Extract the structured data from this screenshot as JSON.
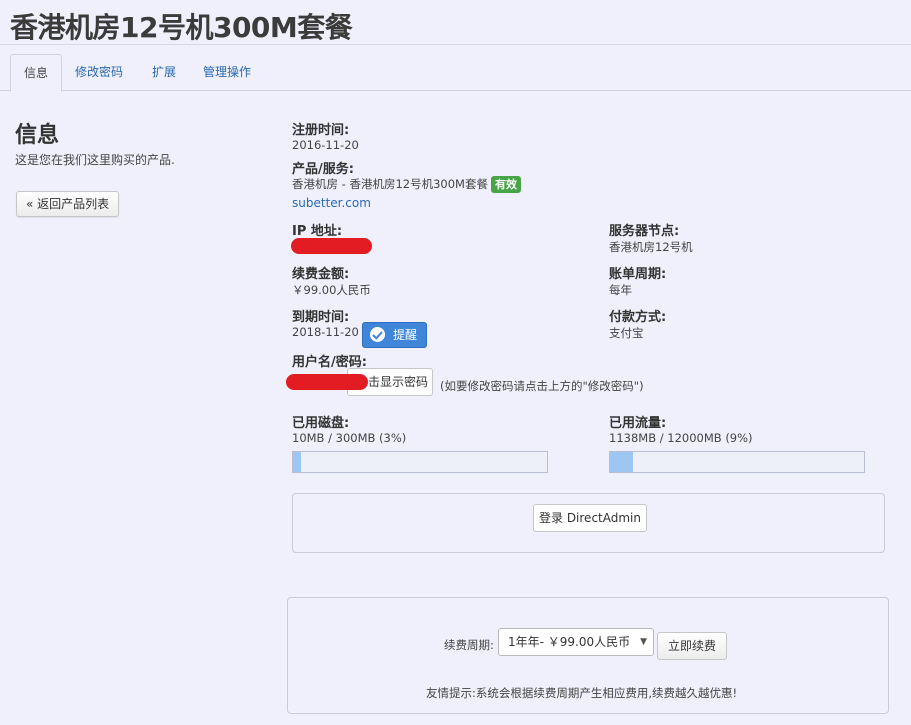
{
  "page": {
    "title": "香港机房12号机300M套餐"
  },
  "tabs": [
    {
      "label": "信息"
    },
    {
      "label": "修改密码"
    },
    {
      "label": "扩展"
    },
    {
      "label": "管理操作"
    }
  ],
  "sidebar": {
    "heading": "信息",
    "description": "这是您在我们这里购买的产品.",
    "back_button": "« 返回产品列表"
  },
  "details": {
    "reg_date_label": "注册时间:",
    "reg_date": "2016-11-20",
    "product_label": "产品/服务:",
    "product": "香港机房 - 香港机房12号机300M套餐",
    "status_badge": "有效",
    "domain_link": "subetter.com",
    "ip_label": "IP 地址:",
    "node_label": "服务器节点:",
    "node": "香港机房12号机",
    "amount_label": "续费金额:",
    "amount": "￥99.00人民币",
    "cycle_label": "账单周期:",
    "cycle": "每年",
    "due_label": "到期时间:",
    "due_date": "2018-11-20",
    "remind_button": "提醒",
    "payment_label": "付款方式:",
    "payment": "支付宝",
    "credentials_label": "用户名/密码:",
    "show_password_button": "击显示密码",
    "password_hint": "(如要修改密码请点击上方的\"修改密码\")"
  },
  "usage": {
    "disk_label": "已用磁盘:",
    "disk_text": "10MB / 300MB (3%)",
    "disk_percent": 3,
    "traffic_label": "已用流量:",
    "traffic_text": "1138MB / 12000MB (9%)",
    "traffic_percent": 9
  },
  "login": {
    "button": "登录 DirectAdmin"
  },
  "renew": {
    "period_label": "续费周期:",
    "period_selected": "1年年- ￥99.00人民币",
    "renew_button": "立即续费",
    "tip": "友情提示:系统会根据续费周期产生相应费用,续费越久越优惠!"
  },
  "colors": {
    "accent": "#3f86d8",
    "status_active": "#47a447",
    "redaction": "#e31b23",
    "progress": "#9dc7f2"
  }
}
